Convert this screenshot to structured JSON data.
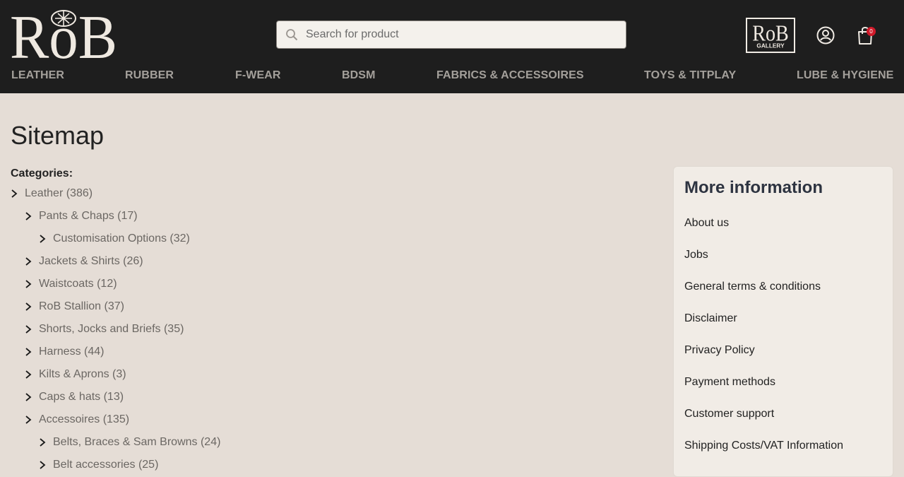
{
  "header": {
    "logo_text": "RoB",
    "search": {
      "placeholder": "Search for product",
      "value": ""
    },
    "gallery_logo_text": "RoB",
    "gallery_logo_subtext": "GALLERY",
    "cart_count": "0"
  },
  "nav": [
    {
      "label": "LEATHER"
    },
    {
      "label": "RUBBER"
    },
    {
      "label": "F-WEAR"
    },
    {
      "label": "BDSM"
    },
    {
      "label": "FABRICS & ACCESSOIRES"
    },
    {
      "label": "TOYS & TITPLAY"
    },
    {
      "label": "LUBE & HYGIENE"
    }
  ],
  "page": {
    "title": "Sitemap",
    "categories_label": "Categories:"
  },
  "categories": [
    {
      "label": "Leather (386)",
      "level": 0
    },
    {
      "label": "Pants & Chaps (17)",
      "level": 1
    },
    {
      "label": "Customisation Options (32)",
      "level": 2
    },
    {
      "label": "Jackets & Shirts (26)",
      "level": 1
    },
    {
      "label": "Waistcoats (12)",
      "level": 1
    },
    {
      "label": "RoB Stallion (37)",
      "level": 1
    },
    {
      "label": "Shorts, Jocks and Briefs (35)",
      "level": 1
    },
    {
      "label": "Harness (44)",
      "level": 1
    },
    {
      "label": "Kilts & Aprons (3)",
      "level": 1
    },
    {
      "label": "Caps & hats (13)",
      "level": 1
    },
    {
      "label": "Accessoires (135)",
      "level": 1
    },
    {
      "label": "Belts, Braces & Sam Browns (24)",
      "level": 2
    },
    {
      "label": "Belt accessories (25)",
      "level": 2
    }
  ],
  "more_info": {
    "title": "More information",
    "links": [
      {
        "label": "About us"
      },
      {
        "label": "Jobs"
      },
      {
        "label": "General terms & conditions"
      },
      {
        "label": "Disclaimer"
      },
      {
        "label": "Privacy Policy"
      },
      {
        "label": "Payment methods"
      },
      {
        "label": "Customer support"
      },
      {
        "label": "Shipping Costs/VAT Information"
      }
    ]
  },
  "colors": {
    "header_bg": "#1e1e1e",
    "page_bg": "#e5ddd6",
    "nav_text": "#a4a09b",
    "badge": "#d11a2a"
  }
}
